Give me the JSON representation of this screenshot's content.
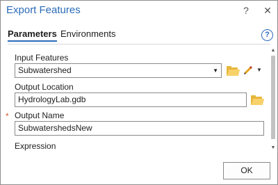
{
  "window": {
    "title": "Export Features",
    "help_glyph": "?",
    "close_glyph": "✕"
  },
  "tabs": [
    {
      "label": "Parameters",
      "active": true
    },
    {
      "label": "Environments",
      "active": false
    }
  ],
  "help_icon_glyph": "?",
  "params": {
    "input_features": {
      "label": "Input Features",
      "value": "Subwatershed",
      "required": false
    },
    "output_location": {
      "label": "Output Location",
      "value": "HydrologyLab.gdb",
      "required": false
    },
    "output_name": {
      "label": "Output Name",
      "value": "SubwatershedsNew",
      "required": true,
      "marker": "*"
    },
    "expression": {
      "label": "Expression"
    }
  },
  "icons": {
    "dropdown": "▼",
    "pencil_dropdown": "▼",
    "scroll_up": "▲",
    "scroll_down": "▼"
  },
  "buttons": {
    "ok": "OK"
  },
  "colors": {
    "accent": "#2a6bb8",
    "required": "#d45a2a",
    "folder": "#e6b63c"
  }
}
